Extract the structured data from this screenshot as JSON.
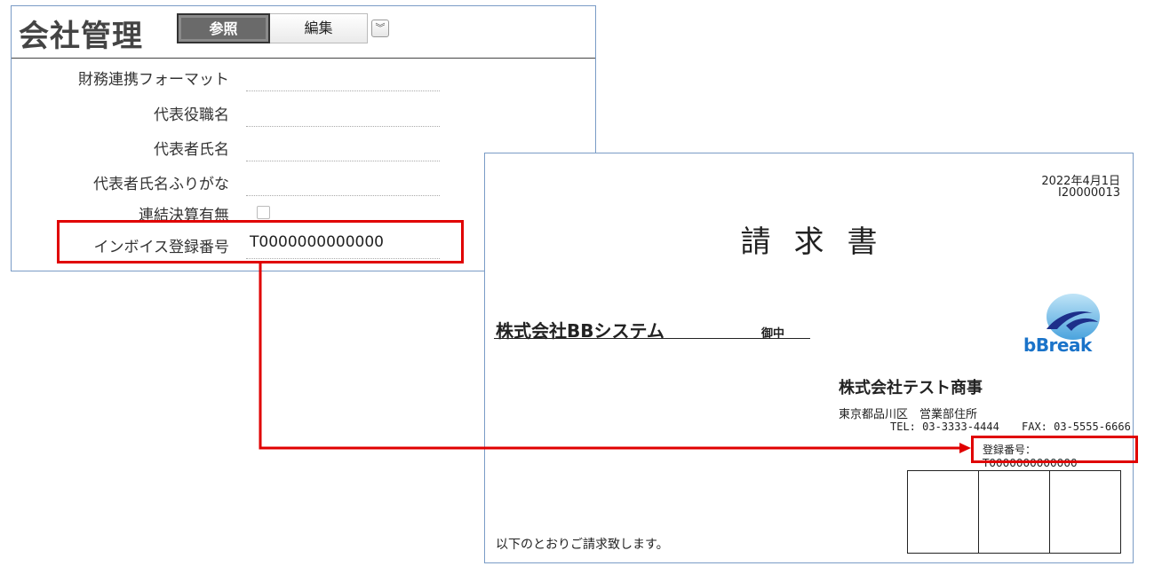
{
  "panel": {
    "title": "会社管理",
    "tabs": [
      {
        "label": "参照",
        "active": true
      },
      {
        "label": "編集",
        "active": false
      }
    ],
    "expand_icon": "double-chevron-down-icon",
    "fields": [
      {
        "label": "財務連携フォーマット",
        "value": ""
      },
      {
        "label": "代表役職名",
        "value": ""
      },
      {
        "label": "代表者氏名",
        "value": ""
      },
      {
        "label": "代表者氏名ふりがな",
        "value": ""
      },
      {
        "label": "連結決算有無",
        "value": "",
        "type": "checkbox",
        "checked": false
      },
      {
        "label": "インボイス登録番号",
        "value": "T0000000000000"
      }
    ]
  },
  "invoice": {
    "date": "2022年4月1日",
    "number": "I20000013",
    "title": "請求書",
    "client": "株式会社BBシステム",
    "honorific": "御中",
    "logo_text": "bBreak",
    "company": "株式会社テスト商事",
    "address": "東京都品川区　営業部住所",
    "tel": "TEL:  03-3333-4444",
    "fax": "FAX:  03-5555-6666",
    "registration": "登録番号：  T0000000000000",
    "note": "以下のとおりご請求致します。"
  },
  "colors": {
    "highlight": "#e00000",
    "panel_border": "#7a9cc6",
    "logo_blue": "#1a73c9"
  }
}
